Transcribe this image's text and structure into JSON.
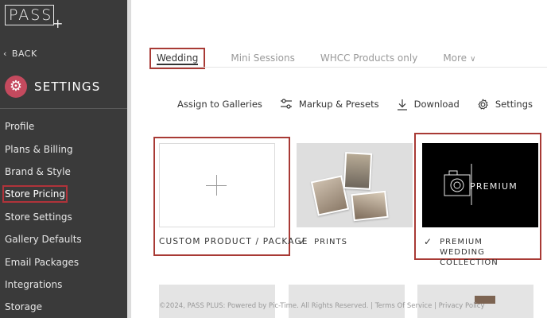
{
  "logo": {
    "text": "PASS",
    "plus": "+"
  },
  "sidebar": {
    "back_label": "BACK",
    "section_title": "SETTINGS",
    "items": [
      {
        "label": "Profile"
      },
      {
        "label": "Plans & Billing"
      },
      {
        "label": "Brand & Style"
      },
      {
        "label": "Store Pricing",
        "active": true
      },
      {
        "label": "Store Settings"
      },
      {
        "label": "Gallery Defaults"
      },
      {
        "label": "Email Packages"
      },
      {
        "label": "Integrations"
      },
      {
        "label": "Storage"
      }
    ]
  },
  "tabs": [
    {
      "label": "Wedding",
      "active": true
    },
    {
      "label": "Mini Sessions"
    },
    {
      "label": "WHCC Products only"
    },
    {
      "label": "More"
    }
  ],
  "toolbar": {
    "assign": "Assign to Galleries",
    "markup": "Markup & Presets",
    "download": "Download",
    "settings": "Settings"
  },
  "cards": [
    {
      "title": "CUSTOM PRODUCT / PACKAGE"
    },
    {
      "title": "PRINTS",
      "checked": true
    },
    {
      "title": "PREMIUM WEDDING COLLECTION",
      "image_text": "PREMIUM",
      "checked": true
    }
  ],
  "footer": "©2024, PASS PLUS: Powered by Pic-Time. All Rights Reserved. | Terms Of Service | Privacy Policy",
  "colors": {
    "sidebar_bg": "#3a3a3a",
    "accent": "#c44a5e",
    "highlight": "#a83a35"
  }
}
